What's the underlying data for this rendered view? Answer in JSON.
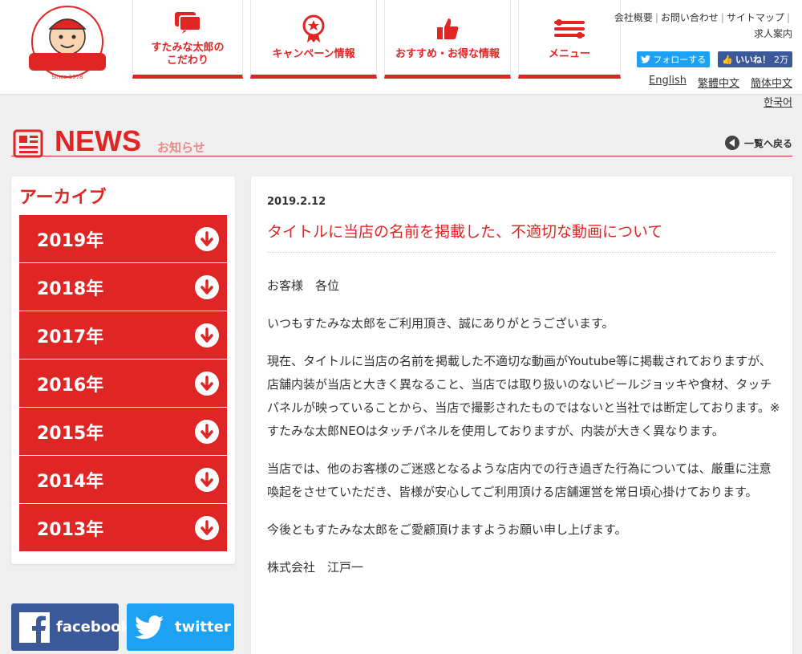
{
  "header": {
    "logo_alt": "すたみな太郎",
    "nav": [
      {
        "label": "すたみな太郎の\nこだわり",
        "icon": "chat-bubble-icon"
      },
      {
        "label": "キャンペーン情報",
        "icon": "badge-star-icon"
      },
      {
        "label": "おすすめ・お得な情報",
        "icon": "thumbs-up-icon"
      },
      {
        "label": "メニュー",
        "icon": "utensils-icon"
      }
    ],
    "util_links": [
      "会社概要",
      "お問い合わせ",
      "サイトマップ",
      "求人案内"
    ],
    "twitter_follow": "フォローする",
    "fb_like": "いいね！",
    "fb_count": "2万",
    "languages": [
      "English",
      "繁體中文",
      "簡体中文",
      "한국어"
    ]
  },
  "news_heading": {
    "title": "NEWS",
    "subtitle": "お知らせ",
    "back_label": "一覧へ戻る"
  },
  "sidebar": {
    "archive_title": "アーカイブ",
    "years": [
      "2019年",
      "2018年",
      "2017年",
      "2016年",
      "2015年",
      "2014年",
      "2013年"
    ],
    "facebook_label": "facebook",
    "twitter_label": "twitter"
  },
  "article": {
    "date": "2019.2.12",
    "title": "タイトルに当店の名前を掲載した、不適切な動画について",
    "paragraphs": [
      "お客様　各位",
      "いつもすたみな太郎をご利用頂き、誠にありがとうございます。",
      "現在、タイトルに当店の名前を掲載した不適切な動画がYoutube等に掲載されておりますが、店舗内装が当店と大きく異なること、当店では取り扱いのないビールジョッキや食材、タッチパネルが映っていることから、当店で撮影されたものではないと当社では断定しております。※すたみな太郎NEOはタッチパネルを使用しておりますが、内装が大きく異なります。",
      "当店では、他のお客様のご迷惑となるような店内での行き過ぎた行為については、厳重に注意喚起をさせていただき、皆様が安心してご利用頂ける店舗運営を常日頃心掛けております。",
      "今後ともすたみな太郎をご愛顧頂けますようお願い申し上げます。",
      "株式会社　江戸一"
    ]
  },
  "colors": {
    "brand_red": "#e02525",
    "facebook": "#3b5998",
    "twitter": "#1da1f2"
  }
}
